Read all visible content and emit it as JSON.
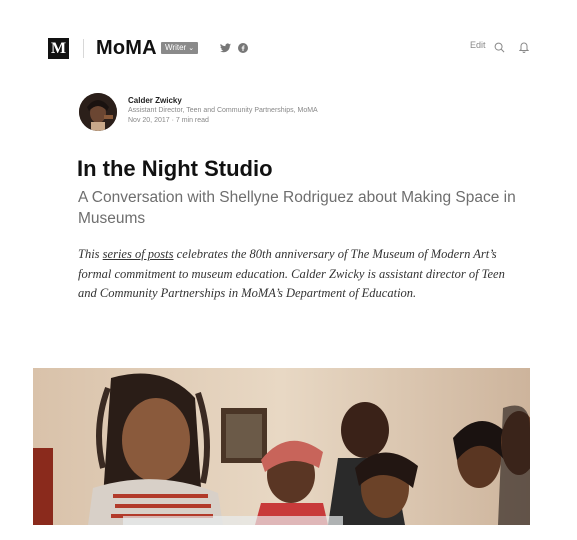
{
  "header": {
    "logo_letter": "M",
    "publication": "MoMA",
    "writer_badge": "Writer",
    "edit": "Edit"
  },
  "author": {
    "name": "Calder Zwicky",
    "bio": "Assistant Director, Teen and Community Partnerships, MoMA",
    "meta": "Nov 20, 2017 · 7 min read"
  },
  "article": {
    "title": "In the Night Studio",
    "subtitle": "A Conversation with Shellyne Rodriguez about Making Space in Museums",
    "intro_before": "This ",
    "intro_link": "series of posts",
    "intro_after": " celebrates the 80th anniversary of The Museum of Modern Art’s formal commitment to museum education. Calder Zwicky is assistant director of Teen and Community Partnerships in MoMA’s Department of Education."
  },
  "icons": {
    "twitter": "twitter-icon",
    "facebook": "facebook-icon",
    "search": "search-icon",
    "bell": "bell-icon",
    "chevron": "chevron-down-icon"
  }
}
